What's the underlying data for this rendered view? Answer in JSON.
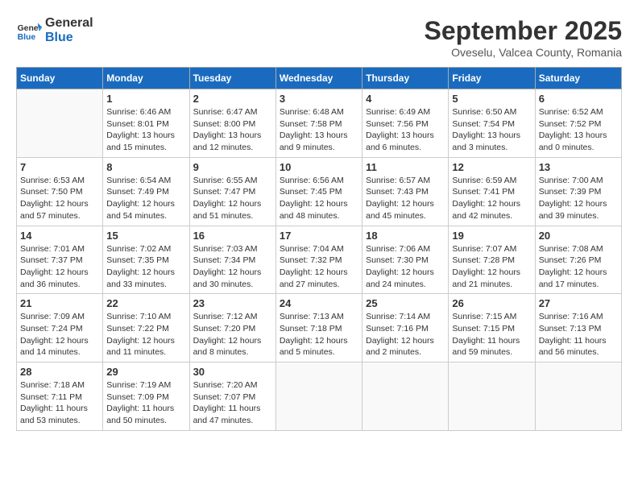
{
  "logo": {
    "line1": "General",
    "line2": "Blue"
  },
  "title": "September 2025",
  "subtitle": "Oveselu, Valcea County, Romania",
  "headers": [
    "Sunday",
    "Monday",
    "Tuesday",
    "Wednesday",
    "Thursday",
    "Friday",
    "Saturday"
  ],
  "weeks": [
    [
      {
        "day": "",
        "info": ""
      },
      {
        "day": "1",
        "info": "Sunrise: 6:46 AM\nSunset: 8:01 PM\nDaylight: 13 hours\nand 15 minutes."
      },
      {
        "day": "2",
        "info": "Sunrise: 6:47 AM\nSunset: 8:00 PM\nDaylight: 13 hours\nand 12 minutes."
      },
      {
        "day": "3",
        "info": "Sunrise: 6:48 AM\nSunset: 7:58 PM\nDaylight: 13 hours\nand 9 minutes."
      },
      {
        "day": "4",
        "info": "Sunrise: 6:49 AM\nSunset: 7:56 PM\nDaylight: 13 hours\nand 6 minutes."
      },
      {
        "day": "5",
        "info": "Sunrise: 6:50 AM\nSunset: 7:54 PM\nDaylight: 13 hours\nand 3 minutes."
      },
      {
        "day": "6",
        "info": "Sunrise: 6:52 AM\nSunset: 7:52 PM\nDaylight: 13 hours\nand 0 minutes."
      }
    ],
    [
      {
        "day": "7",
        "info": "Sunrise: 6:53 AM\nSunset: 7:50 PM\nDaylight: 12 hours\nand 57 minutes."
      },
      {
        "day": "8",
        "info": "Sunrise: 6:54 AM\nSunset: 7:49 PM\nDaylight: 12 hours\nand 54 minutes."
      },
      {
        "day": "9",
        "info": "Sunrise: 6:55 AM\nSunset: 7:47 PM\nDaylight: 12 hours\nand 51 minutes."
      },
      {
        "day": "10",
        "info": "Sunrise: 6:56 AM\nSunset: 7:45 PM\nDaylight: 12 hours\nand 48 minutes."
      },
      {
        "day": "11",
        "info": "Sunrise: 6:57 AM\nSunset: 7:43 PM\nDaylight: 12 hours\nand 45 minutes."
      },
      {
        "day": "12",
        "info": "Sunrise: 6:59 AM\nSunset: 7:41 PM\nDaylight: 12 hours\nand 42 minutes."
      },
      {
        "day": "13",
        "info": "Sunrise: 7:00 AM\nSunset: 7:39 PM\nDaylight: 12 hours\nand 39 minutes."
      }
    ],
    [
      {
        "day": "14",
        "info": "Sunrise: 7:01 AM\nSunset: 7:37 PM\nDaylight: 12 hours\nand 36 minutes."
      },
      {
        "day": "15",
        "info": "Sunrise: 7:02 AM\nSunset: 7:35 PM\nDaylight: 12 hours\nand 33 minutes."
      },
      {
        "day": "16",
        "info": "Sunrise: 7:03 AM\nSunset: 7:34 PM\nDaylight: 12 hours\nand 30 minutes."
      },
      {
        "day": "17",
        "info": "Sunrise: 7:04 AM\nSunset: 7:32 PM\nDaylight: 12 hours\nand 27 minutes."
      },
      {
        "day": "18",
        "info": "Sunrise: 7:06 AM\nSunset: 7:30 PM\nDaylight: 12 hours\nand 24 minutes."
      },
      {
        "day": "19",
        "info": "Sunrise: 7:07 AM\nSunset: 7:28 PM\nDaylight: 12 hours\nand 21 minutes."
      },
      {
        "day": "20",
        "info": "Sunrise: 7:08 AM\nSunset: 7:26 PM\nDaylight: 12 hours\nand 17 minutes."
      }
    ],
    [
      {
        "day": "21",
        "info": "Sunrise: 7:09 AM\nSunset: 7:24 PM\nDaylight: 12 hours\nand 14 minutes."
      },
      {
        "day": "22",
        "info": "Sunrise: 7:10 AM\nSunset: 7:22 PM\nDaylight: 12 hours\nand 11 minutes."
      },
      {
        "day": "23",
        "info": "Sunrise: 7:12 AM\nSunset: 7:20 PM\nDaylight: 12 hours\nand 8 minutes."
      },
      {
        "day": "24",
        "info": "Sunrise: 7:13 AM\nSunset: 7:18 PM\nDaylight: 12 hours\nand 5 minutes."
      },
      {
        "day": "25",
        "info": "Sunrise: 7:14 AM\nSunset: 7:16 PM\nDaylight: 12 hours\nand 2 minutes."
      },
      {
        "day": "26",
        "info": "Sunrise: 7:15 AM\nSunset: 7:15 PM\nDaylight: 11 hours\nand 59 minutes."
      },
      {
        "day": "27",
        "info": "Sunrise: 7:16 AM\nSunset: 7:13 PM\nDaylight: 11 hours\nand 56 minutes."
      }
    ],
    [
      {
        "day": "28",
        "info": "Sunrise: 7:18 AM\nSunset: 7:11 PM\nDaylight: 11 hours\nand 53 minutes."
      },
      {
        "day": "29",
        "info": "Sunrise: 7:19 AM\nSunset: 7:09 PM\nDaylight: 11 hours\nand 50 minutes."
      },
      {
        "day": "30",
        "info": "Sunrise: 7:20 AM\nSunset: 7:07 PM\nDaylight: 11 hours\nand 47 minutes."
      },
      {
        "day": "",
        "info": ""
      },
      {
        "day": "",
        "info": ""
      },
      {
        "day": "",
        "info": ""
      },
      {
        "day": "",
        "info": ""
      }
    ]
  ]
}
